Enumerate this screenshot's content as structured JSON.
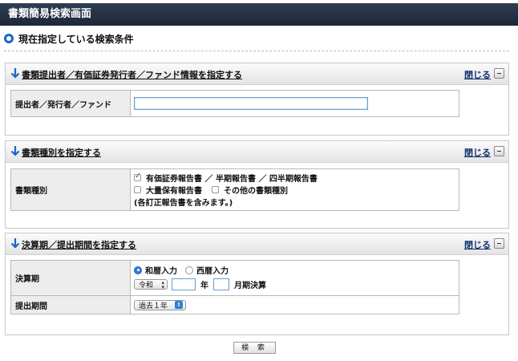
{
  "page": {
    "title": "書類簡易検索画面"
  },
  "current_conditions": {
    "heading": "現在指定している検索条件"
  },
  "panels": {
    "submitter": {
      "title": "書類提出者／有価証券発行者／ファンド情報を指定する",
      "close_label": "閉じる",
      "field_label": "提出者／発行者／ファンド",
      "input_value": ""
    },
    "doc_type": {
      "title": "書類種別を指定する",
      "close_label": "閉じる",
      "field_label": "書類種別",
      "options": [
        {
          "label": "有価証券報告書 ／ 半期報告書 ／ 四半期報告書",
          "checked": true
        },
        {
          "label": "大量保有報告書",
          "checked": false
        },
        {
          "label": "その他の書類種別",
          "checked": false
        }
      ],
      "note": "(各訂正報告書を含みます。)"
    },
    "period": {
      "title": "決算期／提出期間を指定する",
      "close_label": "閉じる",
      "fiscal_label": "決算期",
      "calendar_options": [
        {
          "label": "和暦入力",
          "selected": true
        },
        {
          "label": "西暦入力",
          "selected": false
        }
      ],
      "era_select": "令和",
      "year_value": "",
      "year_unit": "年",
      "month_value": "",
      "month_unit": "月期決算",
      "submission_label": "提出期間",
      "submission_select": "過去１年"
    }
  },
  "search_button": "検 索"
}
